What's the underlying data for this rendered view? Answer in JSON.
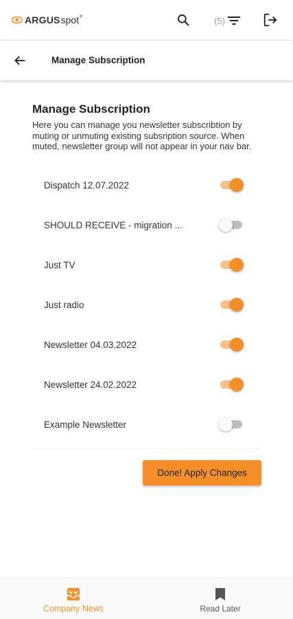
{
  "app": {
    "logo_bold": "ARGUS",
    "logo_light": "spot",
    "logo_reg": "®"
  },
  "topbar": {
    "search_icon": "search-icon",
    "filter_count": "(5)",
    "filter_icon": "filter-icon",
    "logout_icon": "logout-icon"
  },
  "subheader": {
    "back_icon": "arrow-left-icon",
    "title": "Manage Subscription"
  },
  "main": {
    "heading": "Manage Subscription",
    "description": "Here you can manage you newsletter subscribtion by muting or unmuting existing subsription source. When muted, newsletter group will not appear in your nav bar.",
    "subscriptions": [
      {
        "label": "Dispatch 12.07.2022",
        "enabled": true
      },
      {
        "label": "SHOULD RECEIVE - migration ...",
        "enabled": false
      },
      {
        "label": "Just TV",
        "enabled": true
      },
      {
        "label": "Just radio",
        "enabled": true
      },
      {
        "label": "Newsletter 04.03.2022",
        "enabled": true
      },
      {
        "label": "Newsletter 24.02.2022",
        "enabled": true
      },
      {
        "label": "Example Newsletter",
        "enabled": false
      }
    ],
    "apply_button": "Done! Apply Changes"
  },
  "bottom_nav": {
    "items": [
      {
        "label": "Company News",
        "icon": "inbox-icon",
        "active": true
      },
      {
        "label": "Read Later",
        "icon": "bookmark-icon",
        "active": false
      }
    ]
  },
  "colors": {
    "accent": "#f58f2a",
    "accent_light": "#f6c08a",
    "switch_off_track": "#bdbdbd"
  }
}
